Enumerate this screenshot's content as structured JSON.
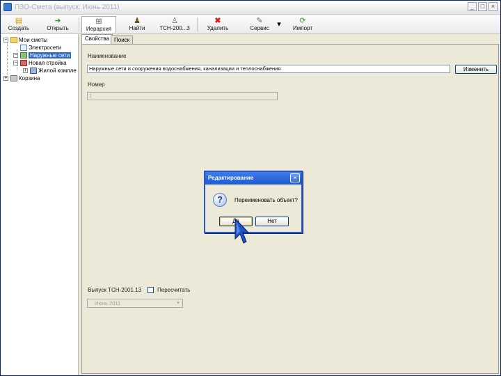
{
  "window": {
    "title": "ПЗО-Смета (выпуск: Июнь 2011)",
    "controls": {
      "minimize": "_",
      "maximize": "□",
      "close": "×"
    }
  },
  "toolbar": {
    "buttons": [
      {
        "label": "Создать",
        "icon": "new-document-icon"
      },
      {
        "label": "Открыть",
        "icon": "open-arrow-icon"
      },
      {
        "label": "Иерархия",
        "icon": "hierarchy-icon",
        "active": true
      },
      {
        "label": "Найти",
        "icon": "find-icon"
      },
      {
        "label": "ТСН-200...3",
        "icon": "catalog-icon"
      },
      {
        "label": "Удалить",
        "icon": "delete-icon"
      },
      {
        "label": "Сервис",
        "icon": "service-icon"
      },
      {
        "label": "Импорт",
        "icon": "import-icon"
      }
    ],
    "dropdown_arrow": "▾"
  },
  "tree": {
    "nodes": [
      {
        "label": "Мои сметы",
        "expander": "−",
        "level": 0
      },
      {
        "label": "Электросети",
        "level": 1
      },
      {
        "label": "Наружные сети",
        "expander": "−",
        "level": 1,
        "selected": true
      },
      {
        "label": "Новая стройка",
        "expander": "−",
        "level": 1
      },
      {
        "label": "Жилой компле",
        "expander": "+",
        "level": 2
      },
      {
        "label": "Корзина",
        "expander": "+",
        "level": 0
      }
    ]
  },
  "properties": {
    "tabs": [
      {
        "label": "Свойства",
        "active": true
      },
      {
        "label": "Поиск"
      }
    ],
    "name_label": "Наименование",
    "name_value": "Наружные сети и сооружения водоснабжения, канализации и теплоснабжения",
    "rename_button": "Изменить",
    "number_label": "Номер",
    "number_value": "1",
    "release_label": "Выпуск ТСН-2001.13",
    "recalc_label": "Пересчитать",
    "release_select": "Июнь 2011"
  },
  "dialog": {
    "title": "Редактирование",
    "close": "×",
    "question_glyph": "?",
    "message": "Переименовать объект?",
    "yes": "Да",
    "no": "Нет"
  }
}
